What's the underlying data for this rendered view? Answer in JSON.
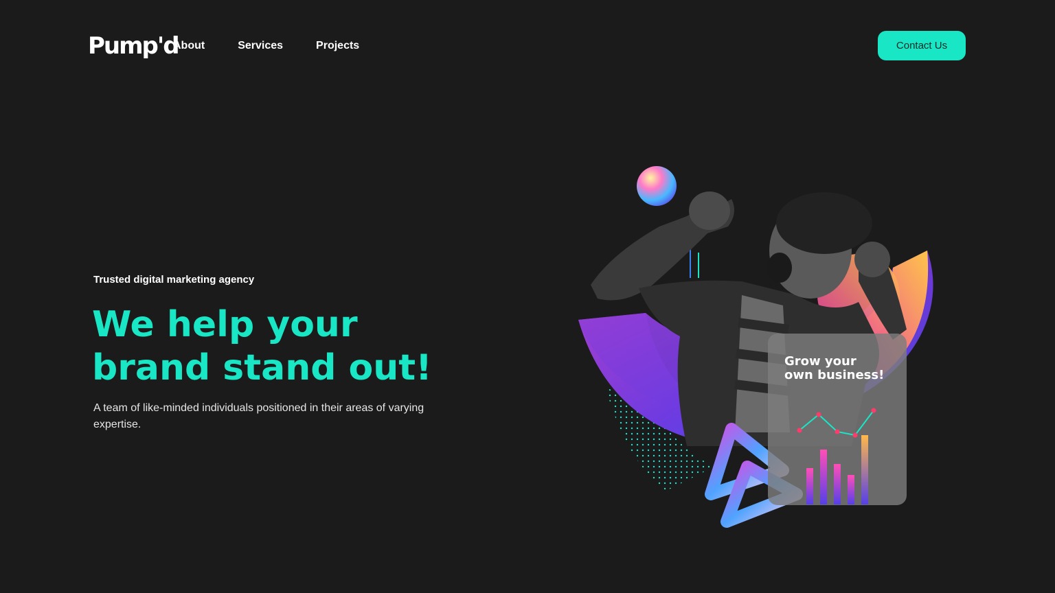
{
  "brand": {
    "logo_text": "Pump'd"
  },
  "nav": {
    "items": [
      "About",
      "Services",
      "Projects"
    ]
  },
  "header": {
    "contact_label": "Contact Us"
  },
  "hero": {
    "eyebrow": "Trusted digital marketing agency",
    "headline_line1": "We help your",
    "headline_line2": "brand stand out!",
    "description": "A team of like-minded individuals positioned in their areas of varying expertise.",
    "card_line1": "Grow your",
    "card_line2": "own business!"
  },
  "colors": {
    "background": "#1b1b1b",
    "accent": "#19e6c5",
    "text": "#ffffff"
  }
}
